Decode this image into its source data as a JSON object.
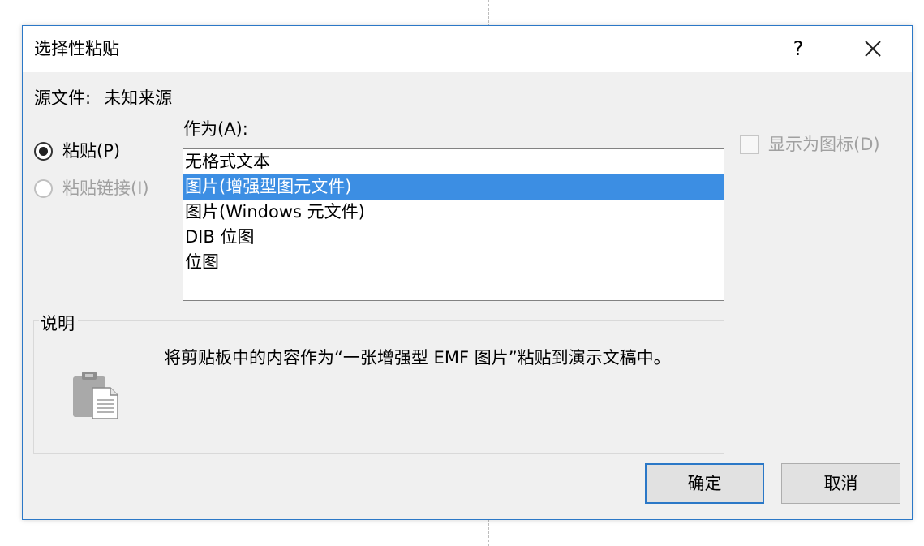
{
  "dialog": {
    "title": "选择性粘贴",
    "help_label": "?",
    "close_icon": "close-icon"
  },
  "source": {
    "label": "源文件:",
    "value": "未知来源"
  },
  "paste_options": [
    {
      "label": "粘贴(P)",
      "selected": true,
      "enabled": true
    },
    {
      "label": "粘贴链接(I)",
      "selected": false,
      "enabled": false
    }
  ],
  "as_list": {
    "label": "作为(A):",
    "items": [
      "无格式文本",
      "图片(增强型图元文件)",
      "图片(Windows 元文件)",
      "DIB 位图",
      "位图"
    ],
    "selected_index": 1
  },
  "display_as_icon": {
    "label": "显示为图标(D)",
    "checked": false,
    "enabled": false
  },
  "description": {
    "title": "说明",
    "text": "将剪贴板中的内容作为“一张增强型 EMF 图片”粘贴到演示文稿中。",
    "icon": "clipboard-icon"
  },
  "buttons": {
    "ok": "确定",
    "cancel": "取消"
  },
  "colors": {
    "accent": "#2b78c7",
    "selection": "#3c8ee3",
    "dialog_bg": "#f0f0f0"
  }
}
